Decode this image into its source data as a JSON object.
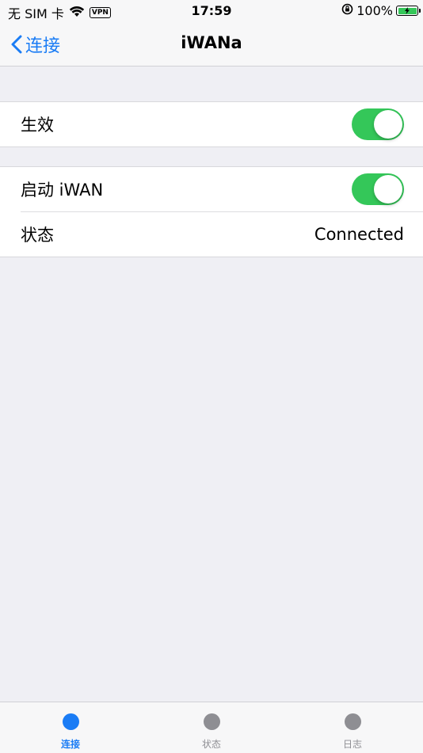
{
  "status_bar": {
    "carrier": "无 SIM 卡",
    "vpn": "VPN",
    "time": "17:59",
    "battery_percent": "100%",
    "battery_level": 1.0
  },
  "nav": {
    "back_label": "连接",
    "title": "iWANa"
  },
  "settings": {
    "enabled_label": "生效",
    "enabled_on": true,
    "start_label": "启动 iWAN",
    "start_on": true,
    "status_label": "状态",
    "status_value": "Connected"
  },
  "tabs": [
    {
      "label": "连接",
      "active": true
    },
    {
      "label": "状态",
      "active": false
    },
    {
      "label": "日志",
      "active": false
    }
  ],
  "colors": {
    "accent": "#1a7cf5",
    "switch_on": "#34c759",
    "inactive": "#8e8e93",
    "background": "#efeff4"
  }
}
